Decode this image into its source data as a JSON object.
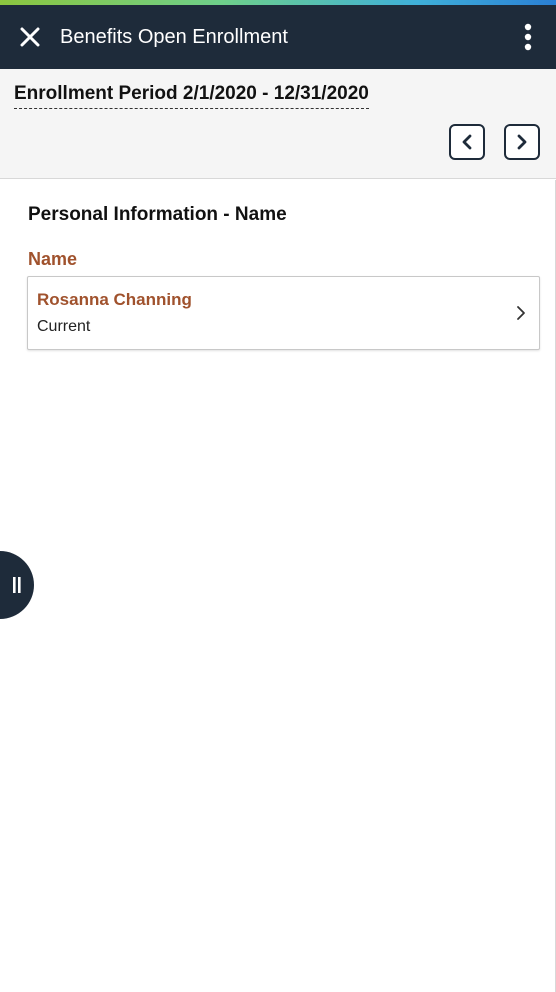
{
  "header": {
    "title": "Benefits Open Enrollment",
    "close_icon": "close-icon",
    "more_icon": "vertical-ellipsis-icon"
  },
  "period": {
    "label": "Enrollment Period 2/1/2020 - 12/31/2020",
    "prev_icon": "chevron-left-icon",
    "next_icon": "chevron-right-icon"
  },
  "section": {
    "title": "Personal Information - Name",
    "group_label": "Name",
    "card": {
      "name": "Rosanna Channing",
      "status": "Current",
      "chevron_icon": "chevron-right-icon"
    }
  },
  "side_tab": {
    "icon": "pause-bars-icon"
  },
  "colors": {
    "header_bg": "#1e2b3a",
    "accent_brown": "#a0522d",
    "period_bg": "#f5f5f5"
  }
}
